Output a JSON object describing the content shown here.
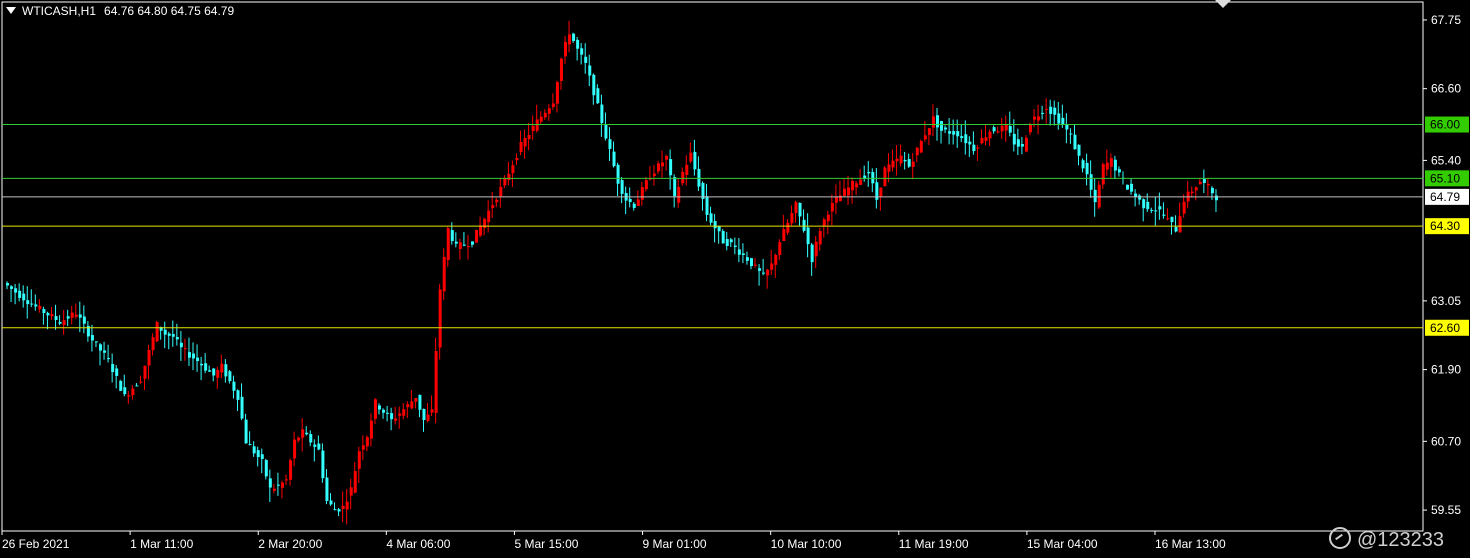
{
  "header": {
    "symbol": "WTICASH,H1",
    "ohlc": "64.76 64.80 64.75 64.79"
  },
  "watermark": {
    "text": "@123233",
    "icon": "weibo-icon"
  },
  "colors": {
    "background": "#000000",
    "bull": "#ff0000",
    "bear": "#33ffff",
    "frame": "#ffffff",
    "green_level": "#33cc33",
    "yellow_level": "#e6e600",
    "current_line": "#c0c0c0"
  },
  "chart_data": {
    "type": "candlestick",
    "timeframe": "H1",
    "symbol": "WTICASH",
    "ylim": [
      59.2,
      68.05
    ],
    "y_ticks": [
      67.75,
      66.6,
      65.4,
      63.05,
      61.9,
      60.7,
      59.55
    ],
    "x_tick_labels": [
      "26 Feb 2021",
      "1 Mar 11:00",
      "2 Mar 20:00",
      "4 Mar 06:00",
      "5 Mar 15:00",
      "9 Mar 01:00",
      "10 Mar 10:00",
      "11 Mar 19:00",
      "15 Mar 04:00",
      "16 Mar 13:00"
    ],
    "levels": [
      {
        "value": 66.0,
        "label": "66.00",
        "color": "green"
      },
      {
        "value": 65.1,
        "label": "65.10",
        "color": "green"
      },
      {
        "value": 64.3,
        "label": "64.30",
        "color": "yellow"
      },
      {
        "value": 62.6,
        "label": "62.60",
        "color": "yellow"
      }
    ],
    "current_price": {
      "value": 64.79,
      "label": "64.79"
    },
    "path": [
      [
        0,
        63.35
      ],
      [
        8,
        62.95
      ],
      [
        14,
        62.7
      ],
      [
        18,
        62.85
      ],
      [
        22,
        62.4
      ],
      [
        26,
        62.05
      ],
      [
        30,
        61.45
      ],
      [
        34,
        61.75
      ],
      [
        38,
        62.65
      ],
      [
        40,
        62.5
      ],
      [
        42,
        62.45
      ],
      [
        44,
        62.25
      ],
      [
        48,
        62.05
      ],
      [
        52,
        61.8
      ],
      [
        54,
        61.95
      ],
      [
        58,
        61.45
      ],
      [
        60,
        60.7
      ],
      [
        64,
        60.35
      ],
      [
        66,
        59.9
      ],
      [
        68,
        59.95
      ],
      [
        70,
        60.05
      ],
      [
        72,
        60.7
      ],
      [
        74,
        60.85
      ],
      [
        78,
        60.55
      ],
      [
        80,
        59.7
      ],
      [
        82,
        59.55
      ],
      [
        84,
        59.6
      ],
      [
        86,
        59.9
      ],
      [
        88,
        60.55
      ],
      [
        90,
        60.8
      ],
      [
        92,
        61.35
      ],
      [
        96,
        61.05
      ],
      [
        100,
        61.3
      ],
      [
        102,
        61.45
      ],
      [
        104,
        61.05
      ],
      [
        106,
        61.2
      ],
      [
        108,
        63.25
      ],
      [
        110,
        64.25
      ],
      [
        112,
        63.95
      ],
      [
        116,
        64.05
      ],
      [
        120,
        64.55
      ],
      [
        124,
        65.05
      ],
      [
        128,
        65.65
      ],
      [
        132,
        66.05
      ],
      [
        136,
        66.4
      ],
      [
        138,
        67.1
      ],
      [
        140,
        67.55
      ],
      [
        142,
        67.25
      ],
      [
        144,
        67.0
      ],
      [
        146,
        66.55
      ],
      [
        148,
        66.05
      ],
      [
        150,
        65.55
      ],
      [
        152,
        65.05
      ],
      [
        154,
        64.75
      ],
      [
        156,
        64.65
      ],
      [
        158,
        64.9
      ],
      [
        160,
        65.15
      ],
      [
        164,
        65.45
      ],
      [
        166,
        64.75
      ],
      [
        168,
        65.2
      ],
      [
        170,
        65.5
      ],
      [
        172,
        65.0
      ],
      [
        174,
        64.5
      ],
      [
        178,
        64.05
      ],
      [
        180,
        64.0
      ],
      [
        184,
        63.75
      ],
      [
        188,
        63.45
      ],
      [
        190,
        63.65
      ],
      [
        192,
        64.05
      ],
      [
        196,
        64.65
      ],
      [
        198,
        64.25
      ],
      [
        200,
        63.75
      ],
      [
        202,
        64.25
      ],
      [
        204,
        64.55
      ],
      [
        206,
        64.75
      ],
      [
        210,
        65.0
      ],
      [
        214,
        65.2
      ],
      [
        216,
        64.75
      ],
      [
        218,
        65.25
      ],
      [
        222,
        65.45
      ],
      [
        224,
        65.3
      ],
      [
        228,
        65.85
      ],
      [
        230,
        66.1
      ],
      [
        232,
        65.9
      ],
      [
        236,
        65.85
      ],
      [
        240,
        65.6
      ],
      [
        244,
        65.9
      ],
      [
        248,
        65.95
      ],
      [
        250,
        65.7
      ],
      [
        252,
        65.6
      ],
      [
        254,
        66.05
      ],
      [
        258,
        66.3
      ],
      [
        262,
        66.0
      ],
      [
        264,
        65.8
      ],
      [
        266,
        65.45
      ],
      [
        268,
        65.15
      ],
      [
        270,
        64.65
      ],
      [
        272,
        65.3
      ],
      [
        274,
        65.4
      ],
      [
        276,
        65.15
      ],
      [
        278,
        64.95
      ],
      [
        282,
        64.65
      ],
      [
        286,
        64.55
      ],
      [
        290,
        64.25
      ],
      [
        292,
        64.75
      ],
      [
        296,
        65.05
      ],
      [
        298,
        64.95
      ],
      [
        300,
        64.79
      ]
    ],
    "x_span": 300
  }
}
